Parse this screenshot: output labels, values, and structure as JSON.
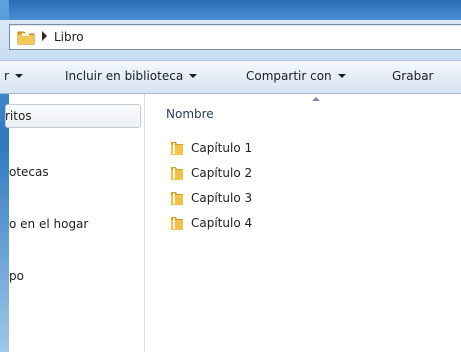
{
  "address_bar": {
    "breadcrumb": [
      "Libro"
    ],
    "folder_icon": "folder-icon",
    "separator_icon": "chevron-right-icon"
  },
  "toolbar": {
    "items": [
      {
        "label": "r",
        "has_dropdown": true
      },
      {
        "label": "Incluir en biblioteca",
        "has_dropdown": true
      },
      {
        "label": "Compartir con",
        "has_dropdown": true
      },
      {
        "label": "Grabar",
        "has_dropdown": false
      }
    ]
  },
  "nav_pane": {
    "items": [
      {
        "label": "ritos",
        "selected": true
      },
      {
        "label": "otecas",
        "selected": false
      },
      {
        "label": "o en el hogar",
        "selected": false
      },
      {
        "label": "po",
        "selected": false
      }
    ]
  },
  "content": {
    "column_header": "Nombre",
    "sort_icon": "sort-ascending-icon",
    "files": [
      {
        "name": "Capítulo 1",
        "icon": "folder-icon"
      },
      {
        "name": "Capítulo 2",
        "icon": "folder-icon"
      },
      {
        "name": "Capítulo 3",
        "icon": "folder-icon"
      },
      {
        "name": "Capítulo 4",
        "icon": "folder-icon"
      }
    ]
  },
  "colors": {
    "folder": "#e8b53a",
    "window_frame": "#4a8fd5",
    "selection": "#eef1f4"
  }
}
